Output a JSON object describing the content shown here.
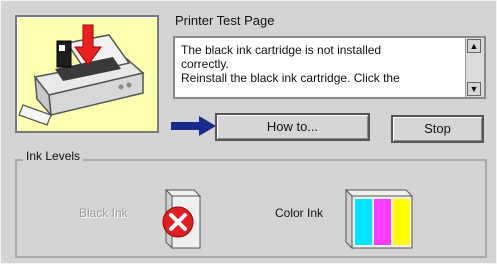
{
  "dialog": {
    "title": "Printer Test Page",
    "message_lines": [
      "The black ink cartridge is not installed",
      "correctly.",
      "Reinstall the black ink cartridge. Click the"
    ],
    "buttons": {
      "how_to": "How to...",
      "stop": "Stop"
    }
  },
  "ink_levels": {
    "label": "Ink Levels",
    "black": {
      "label": "Black Ink",
      "status": "error"
    },
    "color": {
      "label": "Color Ink",
      "status": "ok"
    }
  },
  "colors": {
    "printer_panel_bg": "#ffffb0",
    "arrow": "#1a2a8a",
    "cyan": "#00e5ff",
    "magenta": "#ff3cff",
    "yellow": "#ffff00",
    "error_red": "#e02020"
  },
  "icons": {
    "printer": "printer-icon",
    "arrow": "right-arrow-icon",
    "error": "error-x-icon"
  }
}
